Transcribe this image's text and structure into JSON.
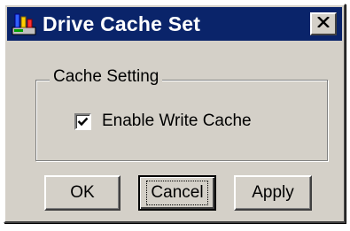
{
  "window": {
    "title": "Drive Cache Set",
    "app_icon": "drive-cache-app-icon",
    "close_icon": "close-icon"
  },
  "group": {
    "label": "Cache Setting"
  },
  "checkbox": {
    "label": "Enable Write Cache",
    "checked": true
  },
  "buttons": {
    "ok": "OK",
    "cancel": "Cancel",
    "apply": "Apply"
  },
  "colors": {
    "titlebar": "#0a246a",
    "face": "#d4d0c8"
  }
}
